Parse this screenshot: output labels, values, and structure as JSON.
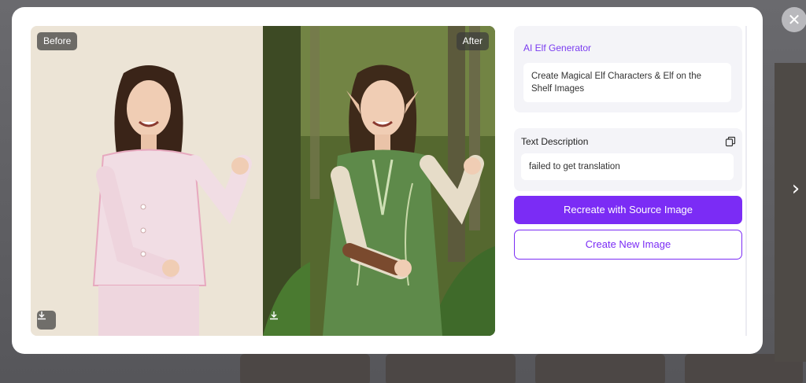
{
  "compare": {
    "before_label": "Before",
    "after_label": "After"
  },
  "side": {
    "generator_title": "AI Elf Generator",
    "generator_subtitle": "Create Magical Elf Characters & Elf on the Shelf Images",
    "text_description_title": "Text Description",
    "text_description_value": "failed to get translation",
    "recreate_button": "Recreate with Source Image",
    "create_new_button": "Create New Image"
  },
  "icons": {
    "close": "close-icon",
    "next": "chevron-right-icon",
    "download": "download-icon",
    "copy": "copy-icon"
  },
  "colors": {
    "accent": "#7b2cf5",
    "generator_title": "#7a3cf0",
    "panel_bg": "#f4f4f8"
  }
}
